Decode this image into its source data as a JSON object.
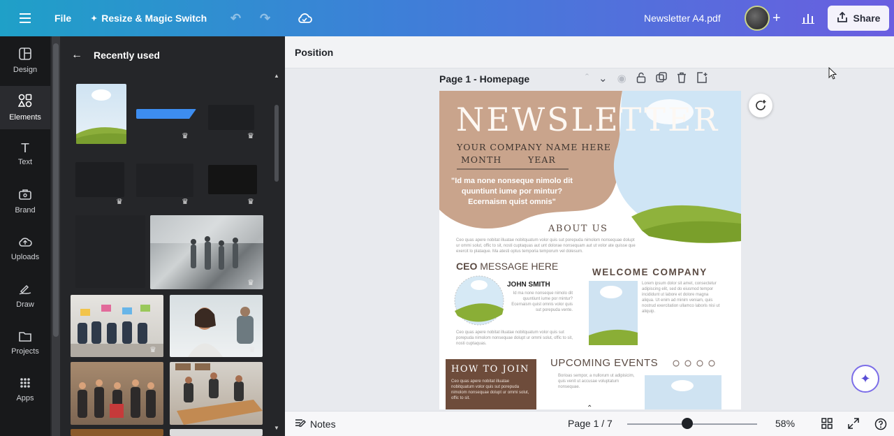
{
  "topbar": {
    "menu_icon": "hamburger-icon",
    "file_label": "File",
    "resize_label": "Resize & Magic Switch",
    "undo_icon": "undo-icon",
    "redo_icon": "redo-icon",
    "cloud_icon": "cloud-sync-icon",
    "doc_title": "Newsletter A4.pdf",
    "add_icon": "plus-icon",
    "analytics_icon": "bar-chart-icon",
    "share_label": "Share"
  },
  "nav": {
    "items": [
      {
        "label": "Design",
        "icon": "design-icon"
      },
      {
        "label": "Elements",
        "icon": "elements-icon"
      },
      {
        "label": "Text",
        "icon": "text-icon"
      },
      {
        "label": "Brand",
        "icon": "brand-icon"
      },
      {
        "label": "Uploads",
        "icon": "uploads-icon"
      },
      {
        "label": "Draw",
        "icon": "draw-icon"
      },
      {
        "label": "Projects",
        "icon": "projects-icon"
      },
      {
        "label": "Apps",
        "icon": "apps-icon"
      }
    ]
  },
  "panel": {
    "back_icon": "arrow-left-icon",
    "title": "Recently used"
  },
  "position_bar": {
    "label": "Position"
  },
  "page": {
    "label": "Page 1 - Homepage"
  },
  "doc": {
    "title": "NEWSLETTER",
    "company": "YOUR COMPANY NAME HERE",
    "month": "MONTH",
    "year": "YEAR",
    "quote": "\"Id ma none nonseque nimolo dit quuntiunt iume por mintur? Ecernaism quist omnis\"",
    "about_heading": "ABOUT US",
    "about_text": "Ceo quas apere nobitat illuatae nobitquatum volor quis sut porepuda nimolom nonsequae dolupt ur ommi solut, offic to sit, nosti cuptaquas aut unt dolorae nonsequam aut ut volor ate quisse que exercit lo plataque. Ma atesti optus temporia temporum vel dolesum.",
    "ceo_heading_bold": "CEO",
    "ceo_heading_rest": "MESSAGE HERE",
    "ceo_name": "JOHN SMITH",
    "ceo_text": "Id ma none nonseque nimolo dit quuntiunt iume por mintur? Ecernaism quist omnis volor quis sut porepuda vente.",
    "ceo_text2": "Ceo quas apere nobitat illuatae nobitquatum volor quis sut porepuda nimolom nonsequae dolupt ur ommi solut, offic to sit, nosti cuptaquas.",
    "welcome_heading": "WELCOME COMPANY",
    "welcome_text": "Lorem ipsum dolor sit amet, consectetur adipiscing elit, sed do eiusmod tempor incididunt ut labore et dolore magna aliqua. Ut enim ad minim veniam, quis nostrud exercitation ullamco laboris nisi ut aliquip.",
    "join_heading": "HOW TO JOIN",
    "join_text": "Ceo quas apere nobitat illuatae nobitquatum volor quis sut porepuda nimolom nonsequae dolupt ur ommi solut, offic to sit.",
    "events_heading": "UPCOMING EVENTS",
    "events_text": "Borioas sempor, a nullorum ut adipisicim, quis venit ut accusae voluptatum nonsequae."
  },
  "bottombar": {
    "notes_label": "Notes",
    "page_counter": "Page 1 / 7",
    "zoom": "58%",
    "grid_icon": "grid-view-icon",
    "fullscreen_icon": "fullscreen-icon",
    "help_icon": "help-icon"
  }
}
